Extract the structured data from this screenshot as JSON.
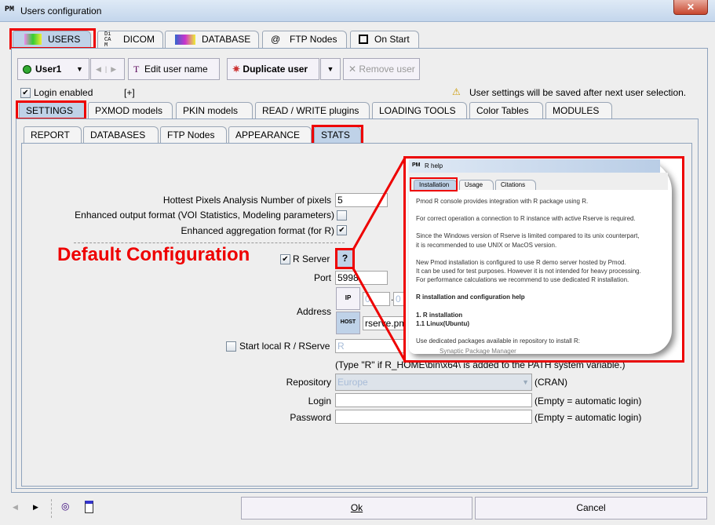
{
  "window": {
    "title": "Users configuration",
    "close": "✕",
    "app_icon": "PM"
  },
  "main_tabs": [
    {
      "label": "USERS",
      "icon": "users-icon"
    },
    {
      "label": "DICOM",
      "icon": "dicom-icon"
    },
    {
      "label": "DATABASE",
      "icon": "database-icon"
    },
    {
      "label": "FTP Nodes",
      "icon": "at-icon"
    },
    {
      "label": "On Start",
      "icon": "start-icon"
    }
  ],
  "toolbar": {
    "user": "User1",
    "edit_user_name": "Edit user name",
    "duplicate_user": "Duplicate user",
    "remove_user": "Remove user",
    "login_enabled": "Login enabled",
    "expand": "[+]",
    "notice": "User settings will be saved after next user selection."
  },
  "settings_tabs": [
    "SETTINGS",
    "PXMOD models",
    "PKIN models",
    "READ / WRITE plugins",
    "LOADING TOOLS",
    "Color Tables",
    "MODULES"
  ],
  "sub_tabs": [
    "REPORT",
    "DATABASES",
    "FTP Nodes",
    "APPEARANCE",
    "STATS"
  ],
  "stats": {
    "hottest_label": "Hottest Pixels Analysis Number of pixels",
    "hottest_value": "5",
    "enhanced_output_label": "Enhanced output format (VOI Statistics, Modeling parameters)",
    "enhanced_output_checked": false,
    "enhanced_aggr_label": "Enhanced aggregation format (for R)",
    "enhanced_aggr_checked": true,
    "r_server_label": "R Server",
    "r_server_checked": true,
    "help_button": "?",
    "port_label": "Port",
    "port_value": "5998",
    "address_label": "Address",
    "ip_1": "0",
    "ip_2": "0",
    "host_value": "rserve.pm",
    "start_local_label": "Start local R / RServe",
    "start_local_checked": false,
    "start_local_value": "R",
    "hint": "(Type \"R\" if R_HOME\\bin\\x64\\ is added to the PATH system variable.)",
    "repository_label": "Repository",
    "repository_value": "Europe",
    "repository_suffix": "(CRAN)",
    "login_label": "Login",
    "login_value": "",
    "login_suffix": "(Empty = automatic login)",
    "password_label": "Password",
    "password_value": "",
    "password_suffix": "(Empty = automatic login)"
  },
  "annotation": "Default Configuration",
  "r_help": {
    "title": "R help",
    "tabs": [
      "Installation",
      "Usage",
      "Citations"
    ],
    "p1": "Pmod R console provides integration with R package using R.",
    "p2": "For correct operation a connection to R instance with active Rserve is required.",
    "p3a": "Since the Windows version of Rserve is limited compared to its unix counterpart,",
    "p3b": "it is recommended to use UNIX or MacOS version.",
    "p4a": "New Pmod installation is configured to use R demo server hosted by Pmod.",
    "p4b": "It can be used for test purposes. However it is not intended for heavy processing.",
    "p4c": "For performance calculations we recommend to use dedicated R installation.",
    "h1": "R installation and configuration help",
    "h2": "1. R installation",
    "h3": "1.1 Linux(Ubuntu)",
    "p5": "Use dedicated packages available in repository to install R:",
    "p6": "Synaptic Package Manager"
  },
  "footer": {
    "ok": "Ok",
    "cancel": "Cancel"
  },
  "colors": {
    "highlight": "#ee0000",
    "selected_tab": "#bfd2e8"
  }
}
